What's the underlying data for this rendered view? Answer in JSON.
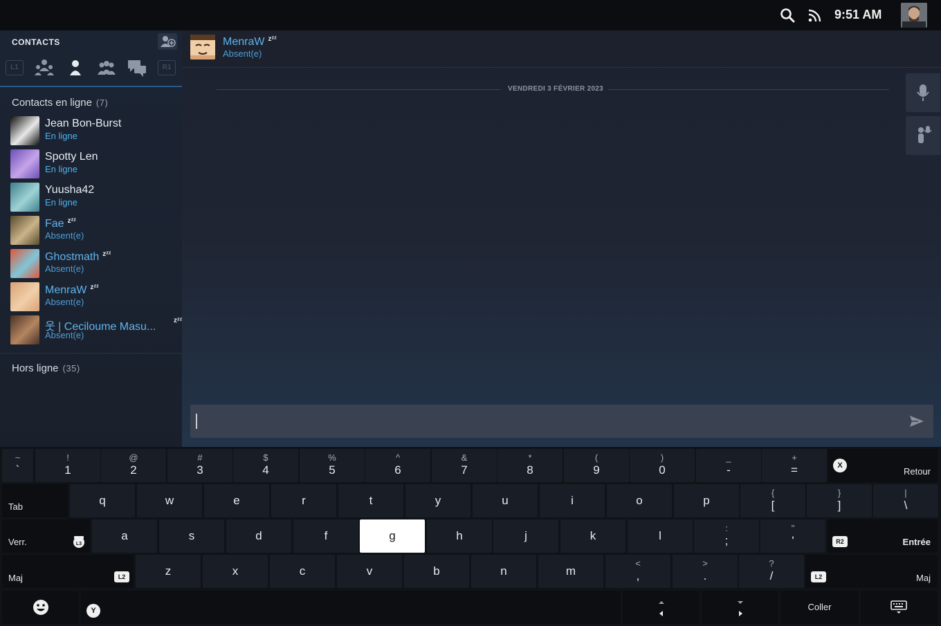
{
  "topbar": {
    "clock": "9:51 AM",
    "icons": [
      "search-icon",
      "rss-icon"
    ]
  },
  "sidebar": {
    "title": "CONTACTS",
    "filters": {
      "left_chip": "L1",
      "right_chip": "R1",
      "icons": [
        "friends-group-icon",
        "person-icon",
        "group-icon",
        "chats-icon"
      ]
    },
    "online_header": {
      "label": "Contacts en ligne",
      "count": "(7)"
    },
    "offline_header": {
      "label": "Hors ligne",
      "count": "(35)"
    },
    "contacts": [
      {
        "name": "Jean Bon-Burst",
        "status": "En ligne",
        "away": false,
        "colors": [
          "#111111",
          "#e8e8e8"
        ]
      },
      {
        "name": "Spotty Len",
        "status": "En ligne",
        "away": false,
        "colors": [
          "#6a4fb8",
          "#c7a4e8"
        ]
      },
      {
        "name": "Yuusha42",
        "status": "En ligne",
        "away": false,
        "colors": [
          "#3f7f8c",
          "#9fd3d6"
        ]
      },
      {
        "name": "Fae",
        "status": "Absent(e)",
        "away": true,
        "colors": [
          "#5a4b2c",
          "#c9b48a"
        ]
      },
      {
        "name": "Ghostmath",
        "status": "Absent(e)",
        "away": true,
        "colors": [
          "#e0573a",
          "#7fc6d9"
        ]
      },
      {
        "name": "MenraW",
        "status": "Absent(e)",
        "away": true,
        "colors": [
          "#d9a277",
          "#f0cfa8"
        ]
      },
      {
        "name": "웃 | Ceciloume Masu...",
        "status": "Absent(e)",
        "away": true,
        "colors": [
          "#4a3126",
          "#b48660"
        ]
      }
    ],
    "zzz": "zᶻᶻ"
  },
  "chat": {
    "name": "MenraW",
    "status": "Absent(e)",
    "date_divider": "VENDREDI 3 FÉVRIER 2023",
    "input_value": ""
  },
  "keyboard": {
    "row1": [
      {
        "main": "`",
        "alt": "~"
      },
      {
        "main": "1",
        "alt": "!"
      },
      {
        "main": "2",
        "alt": "@"
      },
      {
        "main": "3",
        "alt": "#"
      },
      {
        "main": "4",
        "alt": "$"
      },
      {
        "main": "5",
        "alt": "%"
      },
      {
        "main": "6",
        "alt": "^"
      },
      {
        "main": "7",
        "alt": "&"
      },
      {
        "main": "8",
        "alt": "*"
      },
      {
        "main": "9",
        "alt": "("
      },
      {
        "main": "0",
        "alt": ")"
      },
      {
        "main": "-",
        "alt": "_"
      },
      {
        "main": "=",
        "alt": "+"
      }
    ],
    "row2": [
      {
        "main": "q"
      },
      {
        "main": "w"
      },
      {
        "main": "e"
      },
      {
        "main": "r"
      },
      {
        "main": "t"
      },
      {
        "main": "y"
      },
      {
        "main": "u"
      },
      {
        "main": "i"
      },
      {
        "main": "o"
      },
      {
        "main": "p"
      },
      {
        "main": "[",
        "alt": "{"
      },
      {
        "main": "]",
        "alt": "}"
      },
      {
        "main": "\\",
        "alt": "|"
      }
    ],
    "row3": [
      {
        "main": "a"
      },
      {
        "main": "s"
      },
      {
        "main": "d"
      },
      {
        "main": "f"
      },
      {
        "main": "g"
      },
      {
        "main": "h"
      },
      {
        "main": "j"
      },
      {
        "main": "k"
      },
      {
        "main": "l"
      },
      {
        "main": ";",
        "alt": ":"
      },
      {
        "main": "'",
        "alt": "\""
      }
    ],
    "row4": [
      {
        "main": "z"
      },
      {
        "main": "x"
      },
      {
        "main": "c"
      },
      {
        "main": "v"
      },
      {
        "main": "b"
      },
      {
        "main": "n"
      },
      {
        "main": "m"
      },
      {
        "main": ",",
        "alt": "<"
      },
      {
        "main": ".",
        "alt": ">"
      },
      {
        "main": "/",
        "alt": "?"
      }
    ],
    "selected_key": "g",
    "backspace_label": "Retour",
    "backspace_glyph": "X",
    "tab_label": "Tab",
    "caps_label": "Verr.",
    "caps_glyph": "L3",
    "enter_label": "Entrée",
    "enter_glyph": "R2",
    "shift_label": "Maj",
    "shift_glyph": "L2",
    "space_glyph": "Y",
    "paste_label": "Coller"
  }
}
